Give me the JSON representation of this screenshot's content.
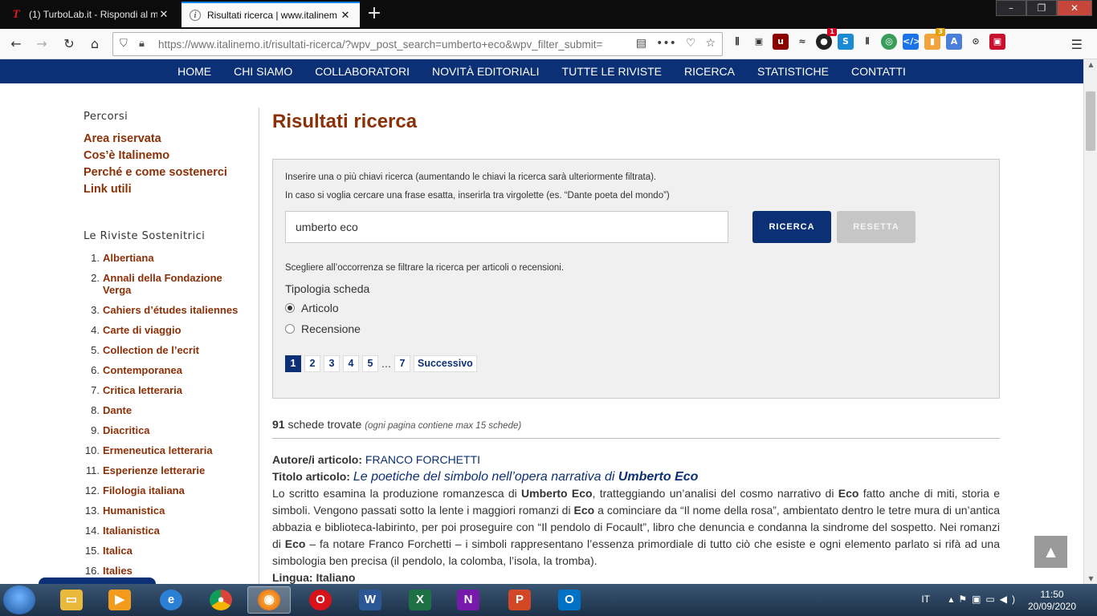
{
  "browser": {
    "tabs": [
      {
        "title": "(1) TurboLab.it - Rispondi al m",
        "favicon": "T"
      },
      {
        "title": "Risultati ricerca | www.italinem",
        "favicon": "i"
      }
    ],
    "url": "https://www.italinemo.it/risultati-ricerca/?wpv_post_search=umberto+eco&wpv_filter_submit=",
    "extension_badges": {
      "ublock": "1",
      "other": "3"
    }
  },
  "nav": [
    "HOME",
    "CHI SIAMO",
    "COLLABORATORI",
    "NOVITÀ EDITORIALI",
    "TUTTE LE RIVISTE",
    "RICERCA",
    "STATISTICHE",
    "CONTATTI"
  ],
  "sidebar": {
    "percorsi_heading": "Percorsi",
    "percorsi": [
      "Area riservata",
      "Cos’è Italinemo",
      "Perché e come sostenerci",
      "Link utili"
    ],
    "riviste_heading": "Le Riviste Sostenitrici",
    "riviste": [
      {
        "n": "1.",
        "name": "Albertiana"
      },
      {
        "n": "2.",
        "name": "Annali della Fondazione Verga"
      },
      {
        "n": "3.",
        "name": "Cahiers d’études italiennes"
      },
      {
        "n": "4.",
        "name": "Carte di viaggio"
      },
      {
        "n": "5.",
        "name": "Collection de l’ecrit"
      },
      {
        "n": "6.",
        "name": "Contemporanea"
      },
      {
        "n": "7.",
        "name": "Critica letteraria"
      },
      {
        "n": "8.",
        "name": "Dante"
      },
      {
        "n": "9.",
        "name": "Diacritica"
      },
      {
        "n": "10.",
        "name": "Ermeneutica letteraria"
      },
      {
        "n": "11.",
        "name": "Esperienze letterarie"
      },
      {
        "n": "12.",
        "name": "Filologia italiana"
      },
      {
        "n": "13.",
        "name": "Humanistica"
      },
      {
        "n": "14.",
        "name": "Italianistica"
      },
      {
        "n": "15.",
        "name": "Italica"
      },
      {
        "n": "16.",
        "name": "Italies"
      }
    ]
  },
  "main": {
    "title": "Risultati ricerca",
    "hint1": "Inserire una o più chiavi ricerca (aumentando le chiavi la ricerca sarà ulteriormente filtrata).",
    "hint2": "In caso si voglia cercare una frase esatta, inserirla tra virgolette (es. “Dante poeta del mondo”)",
    "search_value": "umberto eco",
    "btn_search": "RICERCA",
    "btn_reset": "RESETTA",
    "filter_hint": "Scegliere all’occorrenza se filtrare la ricerca per articoli o recensioni.",
    "tipologia": "Tipologia scheda",
    "options": [
      "Articolo",
      "Recensione"
    ],
    "selected_option": "Articolo",
    "pages": [
      "1",
      "2",
      "3",
      "4",
      "5"
    ],
    "ellipsis": "…",
    "last_page": "7",
    "next": "Successivo",
    "current_page": "1",
    "results_count": "91",
    "results_label": "schede trovate",
    "results_note": "(ogni pagina contiene max 15 schede)",
    "entry": {
      "author_label": "Autore/i articolo:",
      "author": "FRANCO FORCHETTI",
      "title_label": "Titolo articolo:",
      "title_pre": "Le poetiche del simbolo nell’opera narrativa di",
      "title_bold": "Umberto Eco",
      "abstract_parts": [
        {
          "t": "Lo scritto esamina la produzione romanzesca di ",
          "b": false
        },
        {
          "t": "Umberto Eco",
          "b": true
        },
        {
          "t": ", tratteggiando un’analisi del cosmo narrativo di ",
          "b": false
        },
        {
          "t": "Eco",
          "b": true
        },
        {
          "t": " fatto anche di miti, storia e simboli. Vengono passati sotto la lente i maggiori romanzi di ",
          "b": false
        },
        {
          "t": "Eco",
          "b": true
        },
        {
          "t": " a cominciare da “Il nome della rosa”, ambientato dentro le tetre mura di un’antica abbazia e biblioteca-labirinto, per poi proseguire con “Il pendolo di Focault”, libro che denuncia e condanna la sindrome del sospetto. Nei romanzi di ",
          "b": false
        },
        {
          "t": "Eco",
          "b": true
        },
        {
          "t": " – fa notare Franco Forchetti – i simboli rappresentano l’essenza primordiale di tutto ciò che esiste e ogni elemento parlato si rifà ad una simbologia ben precisa (il pendolo, la colomba, l’isola, la tromba).",
          "b": false
        }
      ],
      "lingua_label": "Lingua:",
      "lingua": "Italiano"
    }
  },
  "taskbar": {
    "lang": "IT",
    "time": "11:50",
    "date": "20/09/2020"
  },
  "colors": {
    "brand": "#0c3075",
    "accent": "#8b3007"
  }
}
